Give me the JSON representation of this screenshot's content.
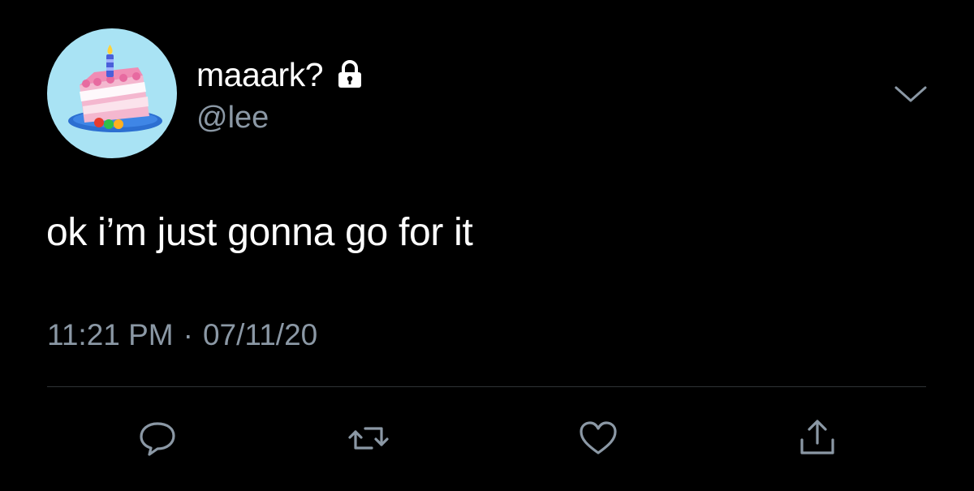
{
  "theme": {
    "background": "#000000",
    "primary_text": "#ffffff",
    "secondary_text": "#8b98a5",
    "divider": "#2f3336",
    "icon_color": "#8b98a5",
    "avatar_bg": "#a9e3f4"
  },
  "author": {
    "display_name": "maaark?",
    "handle": "@lee",
    "protected": true,
    "avatar_icon": "birthday-cake-avatar",
    "lock_icon": "lock-icon"
  },
  "header": {
    "more_icon": "chevron-down-icon"
  },
  "tweet": {
    "text": "ok i’m just gonna go for it",
    "time": "11:21 PM",
    "separator": "·",
    "date": "07/11/20"
  },
  "actions": [
    {
      "name": "reply",
      "icon": "reply-icon"
    },
    {
      "name": "retweet",
      "icon": "retweet-icon"
    },
    {
      "name": "like",
      "icon": "heart-icon"
    },
    {
      "name": "share",
      "icon": "share-icon"
    }
  ]
}
